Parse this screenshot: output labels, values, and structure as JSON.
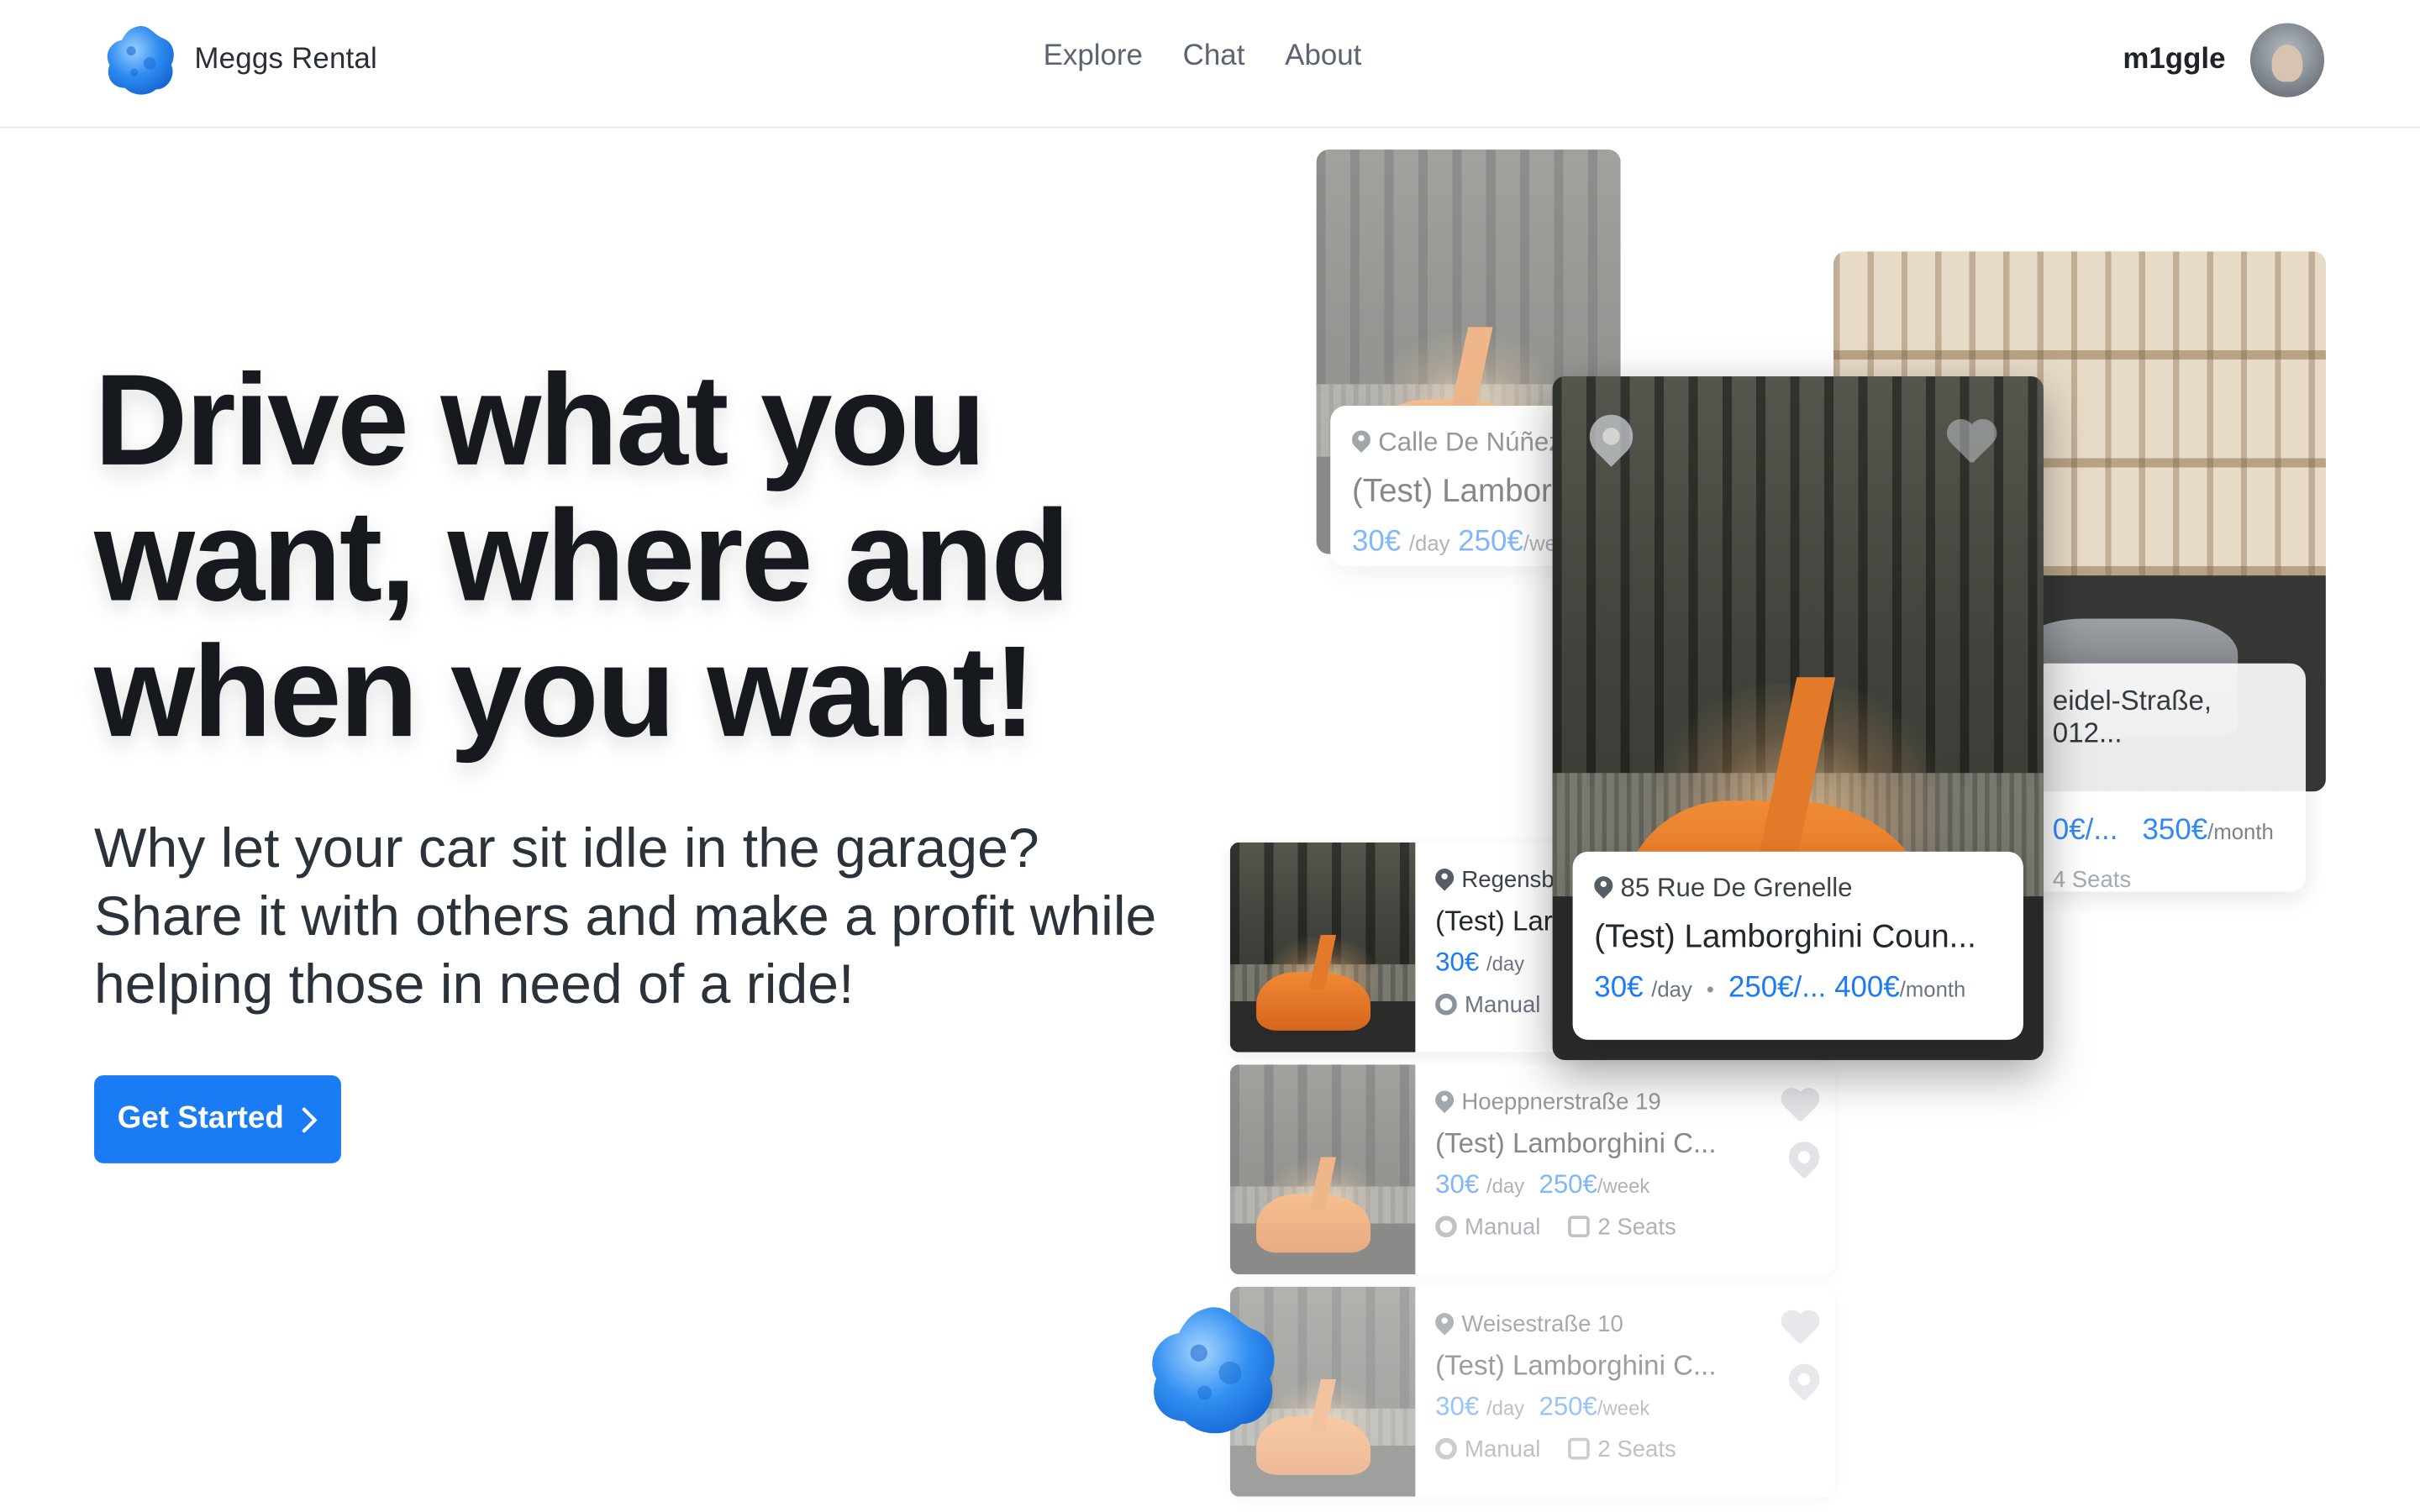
{
  "nav": {
    "brand": "Meggs Rental",
    "links": [
      "Explore",
      "Chat",
      "About"
    ],
    "username": "m1ggle"
  },
  "hero": {
    "title": "Drive what you want, where and when you want!",
    "subtitle": "Why let your car sit idle in the garage? Share it with others and make a profit while helping those in need of a ride!",
    "cta": "Get Started"
  },
  "cards": {
    "top_left": {
      "location": "Calle De Núñez",
      "title": "(Test) Lamborg",
      "price_day": "30€",
      "day_unit": "/day",
      "price_week": "250€",
      "week_unit": "/we"
    },
    "featured": {
      "location": "85 Rue De Grenelle",
      "title": "(Test) Lamborghini Coun...",
      "price_day": "30€",
      "day_unit": "/day",
      "sep": "•",
      "price_week": "250€/...",
      "price_month": "400€",
      "month_unit": "/month"
    },
    "right": {
      "location": "eidel-Straße, 012...",
      "price_week": "0€/...",
      "price_month": "350€",
      "month_unit": "/month",
      "seats": "4 Seats"
    }
  },
  "list": [
    {
      "location": "Regensb",
      "title": "(Test) Lar",
      "price_day": "30€",
      "day_unit": "/day",
      "transmission": "Manual"
    },
    {
      "location": "Hoeppnerstraße 19",
      "title": "(Test) Lamborghini C...",
      "price_day": "30€",
      "day_unit": "/day",
      "price_week": "250€",
      "week_unit": "/week",
      "transmission": "Manual",
      "seats": "2 Seats"
    },
    {
      "location": "Weisestraße 10",
      "title": "(Test) Lamborghini C...",
      "price_day": "30€",
      "day_unit": "/day",
      "price_week": "250€",
      "week_unit": "/week",
      "transmission": "Manual",
      "seats": "2 Seats"
    }
  ],
  "colors": {
    "accent": "#1a7cf5",
    "text_dark": "#16191d",
    "muted": "#6c7580"
  }
}
